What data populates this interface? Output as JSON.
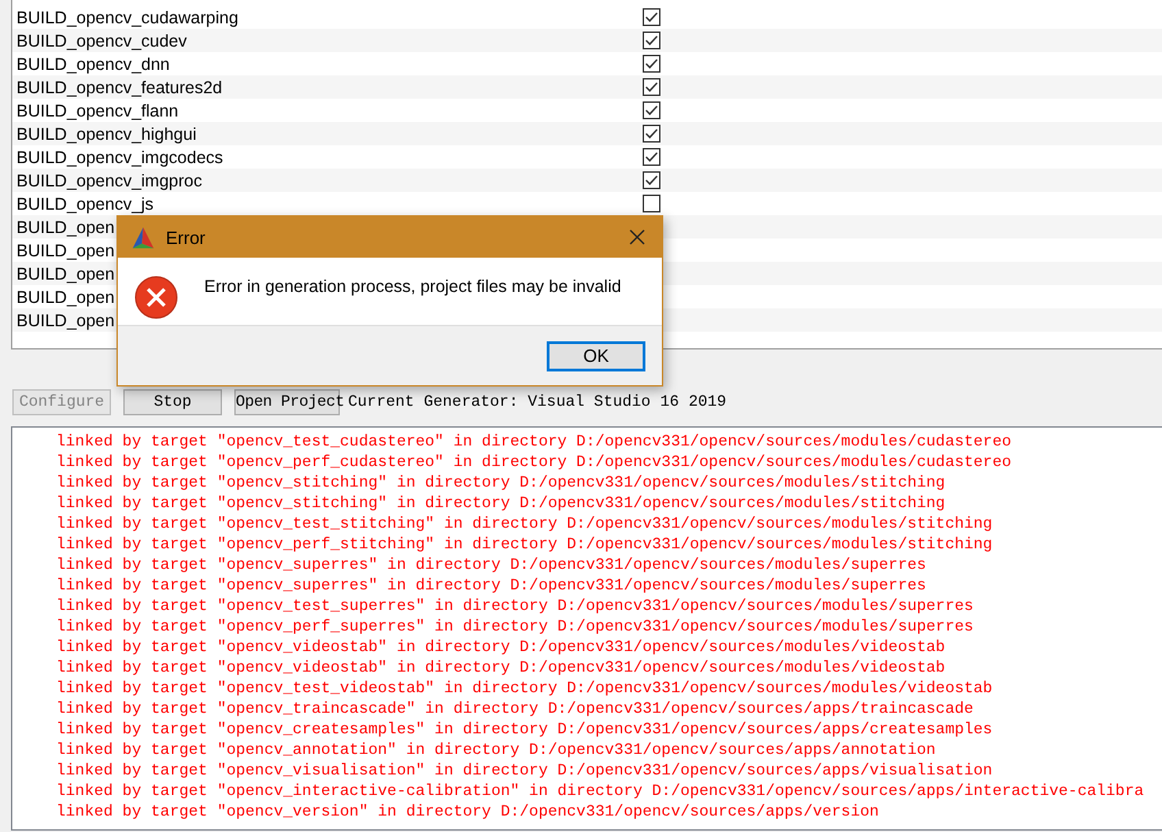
{
  "options_table": {
    "rows": [
      {
        "name": "BUILD_opencv_cudawarping",
        "checked": true
      },
      {
        "name": "BUILD_opencv_cudev",
        "checked": true
      },
      {
        "name": "BUILD_opencv_dnn",
        "checked": true
      },
      {
        "name": "BUILD_opencv_features2d",
        "checked": true
      },
      {
        "name": "BUILD_opencv_flann",
        "checked": true
      },
      {
        "name": "BUILD_opencv_highgui",
        "checked": true
      },
      {
        "name": "BUILD_opencv_imgcodecs",
        "checked": true
      },
      {
        "name": "BUILD_opencv_imgproc",
        "checked": true
      },
      {
        "name": "BUILD_opencv_js",
        "checked": false
      }
    ],
    "covered_rows": [
      "BUILD_open",
      "BUILD_open",
      "BUILD_open",
      "BUILD_open",
      "BUILD_open"
    ]
  },
  "buttons": [
    {
      "label": "Configure",
      "disabled": true
    },
    {
      "label": "Stop",
      "disabled": false
    },
    {
      "label": "Open Project",
      "disabled": false
    }
  ],
  "generator_label": "Current Generator: Visual Studio 16 2019",
  "output_lines": [
    "linked by target \"opencv_test_cudastereo\" in directory D:/opencv331/opencv/sources/modules/cudastereo",
    "linked by target \"opencv_perf_cudastereo\" in directory D:/opencv331/opencv/sources/modules/cudastereo",
    "linked by target \"opencv_stitching\" in directory D:/opencv331/opencv/sources/modules/stitching",
    "linked by target \"opencv_stitching\" in directory D:/opencv331/opencv/sources/modules/stitching",
    "linked by target \"opencv_test_stitching\" in directory D:/opencv331/opencv/sources/modules/stitching",
    "linked by target \"opencv_perf_stitching\" in directory D:/opencv331/opencv/sources/modules/stitching",
    "linked by target \"opencv_superres\" in directory D:/opencv331/opencv/sources/modules/superres",
    "linked by target \"opencv_superres\" in directory D:/opencv331/opencv/sources/modules/superres",
    "linked by target \"opencv_test_superres\" in directory D:/opencv331/opencv/sources/modules/superres",
    "linked by target \"opencv_perf_superres\" in directory D:/opencv331/opencv/sources/modules/superres",
    "linked by target \"opencv_videostab\" in directory D:/opencv331/opencv/sources/modules/videostab",
    "linked by target \"opencv_videostab\" in directory D:/opencv331/opencv/sources/modules/videostab",
    "linked by target \"opencv_test_videostab\" in directory D:/opencv331/opencv/sources/modules/videostab",
    "linked by target \"opencv_traincascade\" in directory D:/opencv331/opencv/sources/apps/traincascade",
    "linked by target \"opencv_createsamples\" in directory D:/opencv331/opencv/sources/apps/createsamples",
    "linked by target \"opencv_annotation\" in directory D:/opencv331/opencv/sources/apps/annotation",
    "linked by target \"opencv_visualisation\" in directory D:/opencv331/opencv/sources/apps/visualisation",
    "linked by target \"opencv_interactive-calibration\" in directory D:/opencv331/opencv/sources/apps/interactive-calibra",
    "linked by target \"opencv_version\" in directory D:/opencv331/opencv/sources/apps/version"
  ],
  "dialog": {
    "title": "Error",
    "message": "Error in generation process, project files may be invalid",
    "button": "OK"
  }
}
